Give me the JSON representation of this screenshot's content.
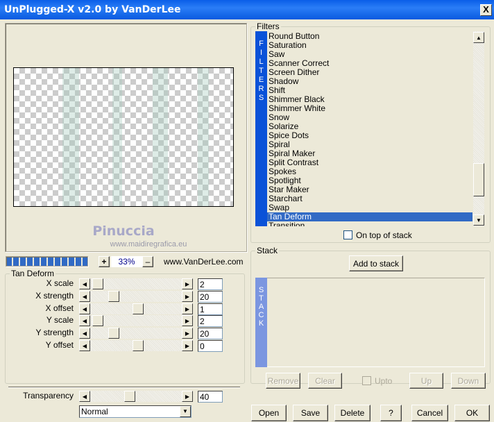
{
  "window": {
    "title": "UnPlugged-X v2.0 by VanDerLee",
    "close_label": "X"
  },
  "preview": {
    "watermark_name": "Pinuccia",
    "watermark_url": "www.maidiregrafica.eu",
    "progress_percent": 100,
    "zoom": "33%",
    "zoom_in": "+",
    "zoom_out": "–",
    "website": "www.VanDerLee.com"
  },
  "params": {
    "group_title": "Tan Deform",
    "rows": [
      {
        "label": "X scale",
        "value": "2",
        "position": 0.0
      },
      {
        "label": "X strength",
        "value": "20",
        "position": 0.2
      },
      {
        "label": "X offset",
        "value": "1",
        "position": 0.5
      },
      {
        "label": "Y scale",
        "value": "2",
        "position": 0.0
      },
      {
        "label": "Y strength",
        "value": "20",
        "position": 0.2
      },
      {
        "label": "Y offset",
        "value": "0",
        "position": 0.5
      }
    ],
    "transparency": {
      "label": "Transparency",
      "value": "40",
      "position": 0.4
    },
    "blend_mode": "Normal"
  },
  "filters": {
    "group_title": "Filters",
    "strip_letters": [
      "F",
      "I",
      "L",
      "T",
      "E",
      "R",
      "S"
    ],
    "items": [
      "Round Button",
      "Saturation",
      "Saw",
      "Scanner Correct",
      "Screen Dither",
      "Shadow",
      "Shift",
      "Shimmer Black",
      "Shimmer White",
      "Snow",
      "Solarize",
      "Spice Dots",
      "Spiral",
      "Spiral Maker",
      "Split Contrast",
      "Spokes",
      "Spotlight",
      "Star Maker",
      "Starchart",
      "Swap",
      "Tan Deform",
      "Transition"
    ],
    "selected": "Tan Deform",
    "on_top_label": "On top of stack",
    "on_top_checked": false
  },
  "stack": {
    "group_title": "Stack",
    "add_label": "Add to stack",
    "strip_letters": [
      "S",
      "T",
      "A",
      "C",
      "K"
    ],
    "remove": "Remove",
    "clear": "Clear",
    "upto": "Upto",
    "up": "Up",
    "down": "Down"
  },
  "footer": {
    "open": "Open",
    "save": "Save",
    "delete": "Delete",
    "help": "?",
    "cancel": "Cancel",
    "ok": "OK"
  },
  "colors": {
    "titlebar": "#0a5ee8",
    "accent": "#0a52d8",
    "selection": "#316ac5",
    "stack_strip": "#7b96e0"
  }
}
